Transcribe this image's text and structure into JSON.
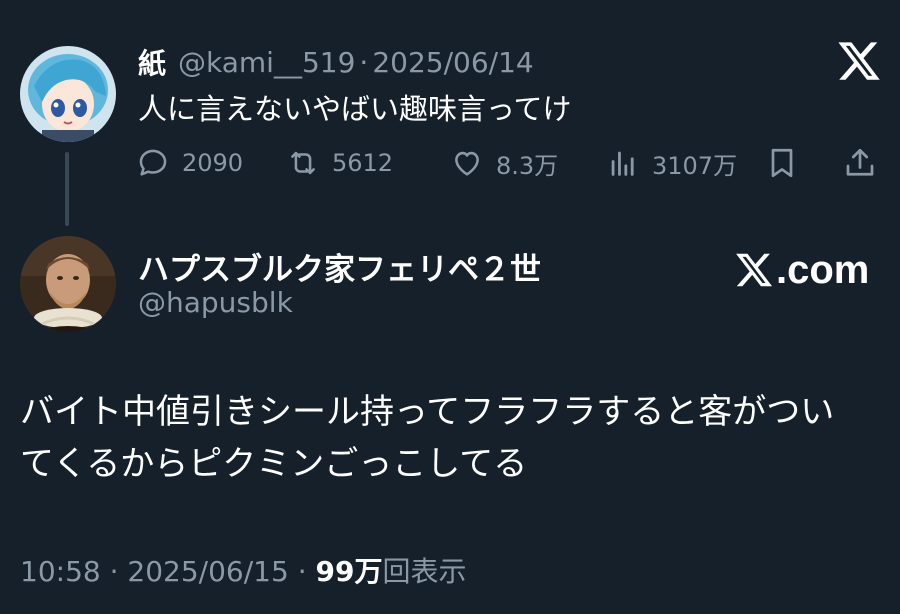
{
  "parent": {
    "name": "紙",
    "handle": "@kami__519",
    "separator": "·",
    "date": "2025/06/14",
    "text": "人に言えないやばい趣味言ってけ",
    "actions": {
      "replies": "2090",
      "retweets": "5612",
      "likes": "8.3万",
      "views": "3107万"
    }
  },
  "main": {
    "name": "ハプスブルク家フェリペ２世",
    "handle": "@hapusblk",
    "watermark_text": ".com",
    "body_lines": [
      "バイト中値引きシール持ってフラフラすると客がつい",
      "てくるからピクミンごっこしてる"
    ],
    "meta": {
      "time": "10:58",
      "separator": "·",
      "date": "2025/06/15",
      "views_count": "99万",
      "views_label": "回表示"
    }
  },
  "colors": {
    "background": "#15202b",
    "text_primary": "#ffffff",
    "text_secondary": "#8b98a5",
    "thread_line": "#3a4754"
  },
  "icons": [
    "x-logo-icon",
    "reply-icon",
    "retweet-icon",
    "like-icon",
    "views-icon",
    "bookmark-icon",
    "share-icon"
  ]
}
